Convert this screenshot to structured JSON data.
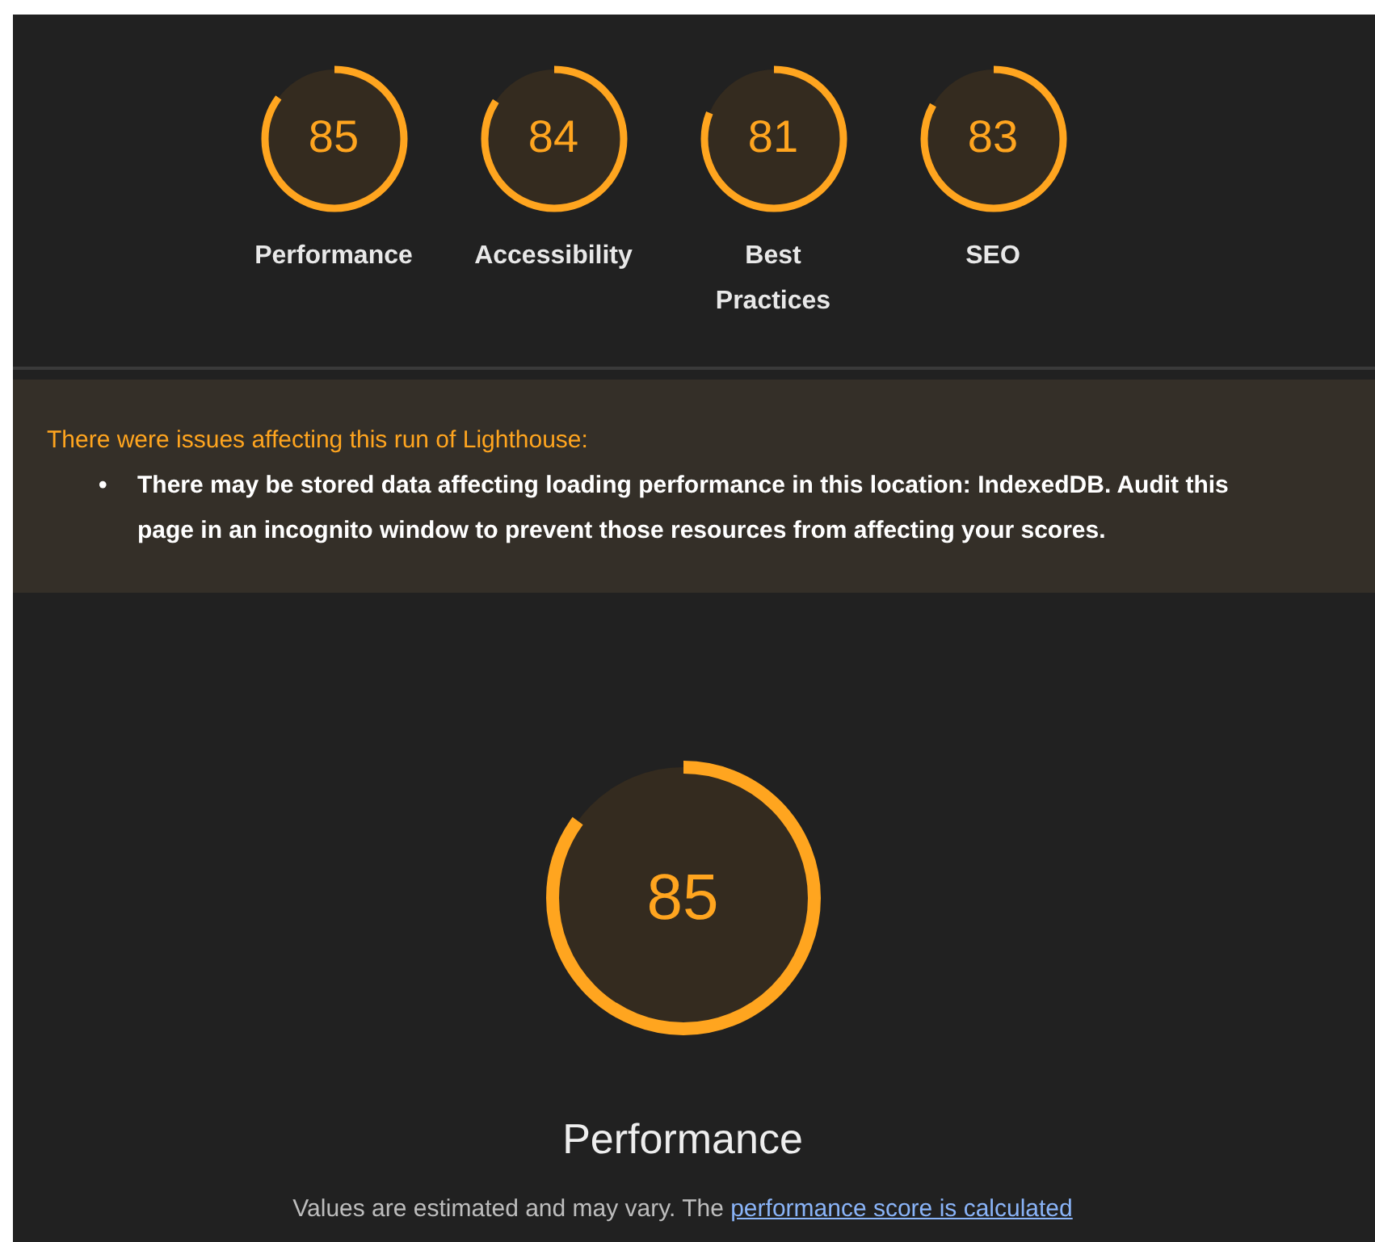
{
  "summary_gauges": [
    {
      "score": "85",
      "level": 0.85,
      "label": "Performance"
    },
    {
      "score": "84",
      "level": 0.84,
      "label": "Accessibility"
    },
    {
      "score": "81",
      "level": 0.81,
      "label": "Best Practices"
    },
    {
      "score": "83",
      "level": 0.83,
      "label": "SEO"
    }
  ],
  "warning": {
    "heading": "There were issues affecting this run of Lighthouse:",
    "bullet": "•",
    "items": [
      "There may be stored data affecting loading performance in this location: IndexedDB. Audit this page in an incognito window to prevent those resources from affecting your scores."
    ]
  },
  "category": {
    "score": "85",
    "level": 0.85,
    "title": "Performance",
    "description": "Values are estimated and may vary. The ",
    "link": "performance score is calculated"
  }
}
